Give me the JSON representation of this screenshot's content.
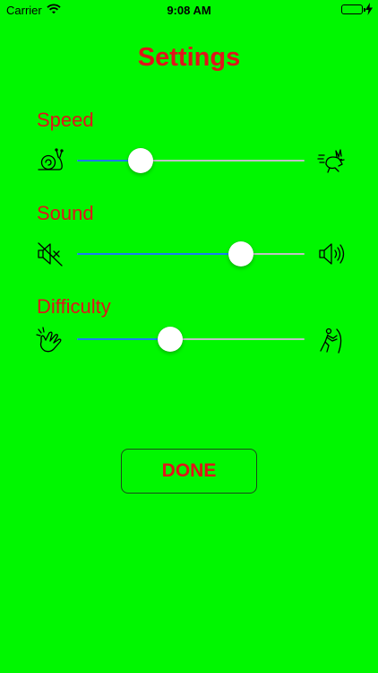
{
  "status_bar": {
    "carrier": "Carrier",
    "time": "9:08 AM",
    "wifi_icon": "wifi-icon",
    "battery_icon": "battery-icon",
    "charging_icon": "charging-bolt-icon"
  },
  "title": "Settings",
  "settings": {
    "speed": {
      "label": "Speed",
      "value": 0.28,
      "min_icon": "snail-icon",
      "max_icon": "rabbit-icon"
    },
    "sound": {
      "label": "Sound",
      "value": 0.72,
      "min_icon": "speaker-muted-icon",
      "max_icon": "speaker-loud-icon"
    },
    "difficulty": {
      "label": "Difficulty",
      "value": 0.41,
      "min_icon": "finger-snap-icon",
      "max_icon": "person-pushing-icon"
    }
  },
  "done_button": {
    "label": "DONE"
  },
  "colors": {
    "background": "#00f700",
    "accent_text": "#e0141a",
    "slider_fill": "#1b7cf5",
    "slider_track": "#bfc1c3"
  }
}
